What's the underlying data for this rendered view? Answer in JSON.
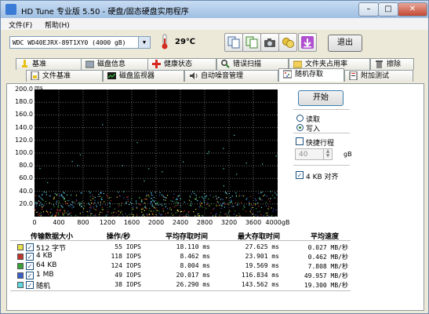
{
  "window": {
    "title": "HD Tune 专业版 5.50 - 硬盘/固态硬盘实用程序"
  },
  "menu": [
    "文件(F)",
    "帮助(H)"
  ],
  "toolbar": {
    "drive": "WDC   WD40EJRX-89T1XY0 (4000 gB)",
    "temperature": "29℃",
    "exit_label": "退出"
  },
  "tabs_row1": [
    {
      "label": "基准",
      "icon": "benchmark-icon"
    },
    {
      "label": "磁盘信息",
      "icon": "disk-info-icon"
    },
    {
      "label": "健康状态",
      "icon": "health-icon"
    },
    {
      "label": "错误扫描",
      "icon": "error-scan-icon"
    },
    {
      "label": "文件夹占用率",
      "icon": "folder-icon"
    },
    {
      "label": "擦除",
      "icon": "erase-icon"
    }
  ],
  "tabs_row2": [
    {
      "label": "文件基准",
      "icon": "file-benchmark-icon"
    },
    {
      "label": "磁盘监视器",
      "icon": "disk-monitor-icon"
    },
    {
      "label": "自动噪音管理",
      "icon": "speaker-icon"
    },
    {
      "label": "随机存取",
      "icon": "random-access-icon",
      "active": true
    },
    {
      "label": "附加测试",
      "icon": "extra-tests-icon"
    }
  ],
  "chart_data": {
    "type": "scatter",
    "ylabel_unit": "ms",
    "y_ticks": [
      "200.0",
      "180.0",
      "160.0",
      "140.0",
      "120.0",
      "100.0",
      "80.0",
      "60.0",
      "40.0",
      "20.0"
    ],
    "x_ticks": [
      "0",
      "400",
      "800",
      "1200",
      "1600",
      "2000",
      "2400",
      "2800",
      "3200",
      "3600",
      "4000gB"
    ],
    "xlim": [
      0,
      4000
    ],
    "ylim": [
      0,
      200
    ],
    "grid": true,
    "series": [
      {
        "name": "512 字节",
        "color": "#e8e04a",
        "y_range_ms": [
          0,
          35
        ]
      },
      {
        "name": "4 KB",
        "color": "#c0342a",
        "y_range_ms": [
          0,
          35
        ]
      },
      {
        "name": "64 KB",
        "color": "#3aa03a",
        "y_range_ms": [
          0,
          35
        ]
      },
      {
        "name": "1 MB",
        "color": "#3a5fc8",
        "y_range_ms": [
          0,
          40
        ]
      },
      {
        "name": "随机",
        "color": "#5fd7e0",
        "y_range_ms": [
          0,
          150
        ]
      }
    ]
  },
  "controls": {
    "start_label": "开始",
    "read_label": "读取",
    "write_label": "写入",
    "short_stroke_label": "快捷行程",
    "short_stroke_value": "40",
    "short_stroke_unit": "gB",
    "align_label": "4 KB 对齐",
    "mode": "write",
    "short_stroke_checked": false,
    "align_checked": true
  },
  "table": {
    "headers": [
      "传输数据大小",
      "操作/秒",
      "平均存取时间",
      "最大存取时间",
      "平均速度"
    ],
    "rows": [
      {
        "size": "512 字节",
        "ops": "55 IOPS",
        "avg": "18.110 ms",
        "max": "27.625 ms",
        "speed": "0.027 MB/秒",
        "color": "#e8e04a"
      },
      {
        "size": "4 KB",
        "ops": "118 IOPS",
        "avg": "8.462 ms",
        "max": "23.901 ms",
        "speed": "0.462 MB/秒",
        "color": "#c0342a"
      },
      {
        "size": "64 KB",
        "ops": "124 IOPS",
        "avg": "8.004 ms",
        "max": "19.569 ms",
        "speed": "7.808 MB/秒",
        "color": "#3aa03a"
      },
      {
        "size": "1 MB",
        "ops": "49 IOPS",
        "avg": "20.017 ms",
        "max": "116.834 ms",
        "speed": "49.957 MB/秒",
        "color": "#3a5fc8"
      },
      {
        "size": "随机",
        "ops": "38 IOPS",
        "avg": "26.290 ms",
        "max": "143.562 ms",
        "speed": "19.300 MB/秒",
        "color": "#5fd7e0"
      }
    ]
  }
}
